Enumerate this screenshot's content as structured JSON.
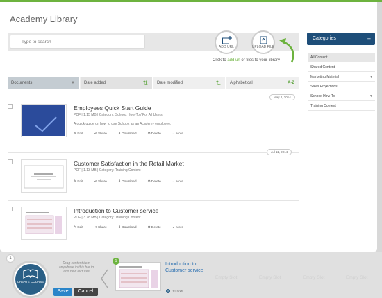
{
  "title": "Academy Library",
  "search": {
    "placeholder": "Type to search"
  },
  "add_url": "ADD URL",
  "upload_file": "UPLOAD FILE",
  "hint": {
    "prefix": "Click to ",
    "link": "add url",
    "suffix": " or files to your library"
  },
  "sort": {
    "documents": "Documents",
    "date_added": "Date added",
    "date_modified": "Date modified",
    "alphabetical": "Alphabetical",
    "alpha_icon": "A-Z"
  },
  "categories": {
    "header": "Categories",
    "plus": "+",
    "items": [
      {
        "label": "All Content",
        "expandable": false
      },
      {
        "label": "Shared Content",
        "expandable": false
      },
      {
        "label": "Marketing Material",
        "expandable": true
      },
      {
        "label": "Sales Projections",
        "expandable": false
      },
      {
        "label": "Schoox How-To",
        "expandable": true
      },
      {
        "label": "Training Content",
        "expandable": false
      }
    ]
  },
  "documents": [
    {
      "date": "May 2, 2014",
      "title": "Employees Quick Start Guide",
      "meta": "PDF  |  1.15 MB  |  Category: Schoox How-To / For All Users",
      "desc": "A quick guide on how to use Schoox as an Academy employee."
    },
    {
      "date": "Jul 11, 2014",
      "title": "Customer Satisfaction in the Retail Market",
      "meta": "PDF  |  1.13 MB  |  Category: Training Content",
      "desc": ""
    },
    {
      "date": "",
      "title": "Introduction to Customer service",
      "meta": "PDF  |  3.78 MB  |  Category: Training Content",
      "desc": ""
    }
  ],
  "actions": {
    "edit": "Edit",
    "share": "Share",
    "download": "Download",
    "delete": "Delete",
    "more": "More"
  },
  "bottom": {
    "step_number": "1",
    "create_course": "CREATE COURSE",
    "drag_hint": "Drag content item anywhere in this bar to add new lectures",
    "save": "Save",
    "cancel": "Cancel",
    "slot_number": "1",
    "slot_title": "Introduction to Customer service",
    "remove": "remove",
    "empty_slot": "Empty Slot"
  }
}
